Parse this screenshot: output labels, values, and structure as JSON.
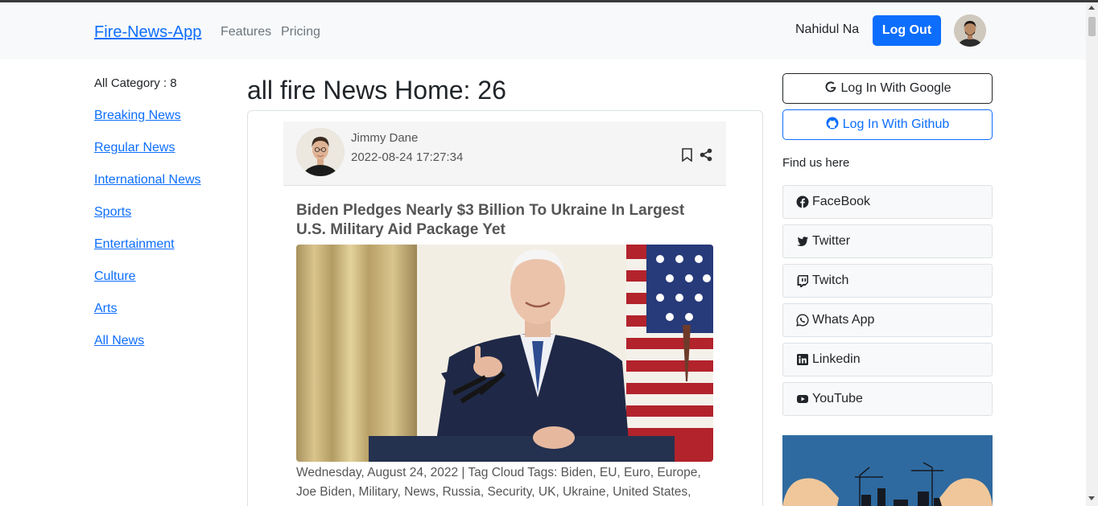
{
  "navbar": {
    "brand": "Fire-News-App",
    "links": [
      "Features",
      "Pricing"
    ],
    "user_name": "Nahidul Na",
    "logout_label": "Log Out"
  },
  "sidebar": {
    "category_count": "All Category : 8",
    "categories": [
      "Breaking News",
      "Regular News",
      "International News",
      "Sports",
      "Entertainment",
      "Culture",
      "Arts",
      "All News"
    ]
  },
  "main": {
    "heading": "all fire News Home: 26",
    "card": {
      "author": "Jimmy Dane",
      "date": "2022-08-24 17:27:34",
      "title": "Biden Pledges Nearly $3 Billion To Ukraine In Largest U.S. Military Aid Package Yet",
      "details": "Wednesday, August 24, 2022 | Tag Cloud Tags: Biden, EU, Euro, Europe, Joe Biden, Military, News, Russia, Security, UK, Ukraine, United States,"
    }
  },
  "right": {
    "google_label": "Log In With Google",
    "github_label": "Log In With Github",
    "find_us": "Find us here",
    "social": [
      "FaceBook",
      "Twitter",
      "Twitch",
      "Whats App",
      "Linkedin",
      "YouTube"
    ]
  },
  "colors": {
    "primary": "#0d6efd",
    "navbar_bg": "#f8f9fa",
    "promo_bg": "#2e6aa0"
  }
}
